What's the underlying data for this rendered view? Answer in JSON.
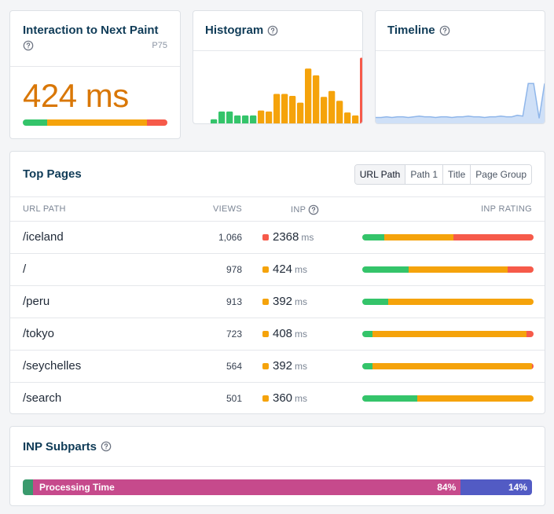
{
  "colors": {
    "good": "#34c46a",
    "needs_improvement": "#f5a30b",
    "poor": "#f65a4a",
    "accent_value": "#d97706"
  },
  "inp_card": {
    "title": "Interaction to Next Paint",
    "help_icon": "question-circle-icon",
    "percentile": "P75",
    "value": "424 ms",
    "rating_distribution": [
      0.14,
      0.58,
      0.12
    ]
  },
  "histogram": {
    "title": "Histogram",
    "help_icon": "question-circle-icon",
    "bars": [
      {
        "v": 0.05,
        "c": "good"
      },
      {
        "v": 0.13,
        "c": "good"
      },
      {
        "v": 0.13,
        "c": "good"
      },
      {
        "v": 0.09,
        "c": "good"
      },
      {
        "v": 0.09,
        "c": "good"
      },
      {
        "v": 0.09,
        "c": "good"
      },
      {
        "v": 0.14,
        "c": "needs_improvement"
      },
      {
        "v": 0.13,
        "c": "needs_improvement"
      },
      {
        "v": 0.31,
        "c": "needs_improvement"
      },
      {
        "v": 0.31,
        "c": "needs_improvement"
      },
      {
        "v": 0.29,
        "c": "needs_improvement"
      },
      {
        "v": 0.22,
        "c": "needs_improvement"
      },
      {
        "v": 0.57,
        "c": "needs_improvement"
      },
      {
        "v": 0.5,
        "c": "needs_improvement"
      },
      {
        "v": 0.28,
        "c": "needs_improvement"
      },
      {
        "v": 0.34,
        "c": "needs_improvement"
      },
      {
        "v": 0.24,
        "c": "needs_improvement"
      },
      {
        "v": 0.12,
        "c": "needs_improvement"
      },
      {
        "v": 0.09,
        "c": "needs_improvement"
      },
      {
        "v": 0.68,
        "c": "poor"
      }
    ]
  },
  "timeline": {
    "title": "Timeline",
    "help_icon": "question-circle-icon",
    "points": [
      0.09,
      0.09,
      0.1,
      0.09,
      0.1,
      0.1,
      0.09,
      0.1,
      0.11,
      0.1,
      0.1,
      0.09,
      0.1,
      0.1,
      0.09,
      0.1,
      0.1,
      0.11,
      0.1,
      0.1,
      0.09,
      0.1,
      0.1,
      0.11,
      0.1,
      0.1,
      0.12,
      0.11,
      0.55,
      0.55,
      0.08,
      0.55
    ]
  },
  "top_pages": {
    "title": "Top Pages",
    "tabs": [
      "URL Path",
      "Path 1",
      "Title",
      "Page Group"
    ],
    "columns": {
      "path": "URL PATH",
      "views": "VIEWS",
      "inp": "INP",
      "rating": "INP RATING"
    },
    "rows": [
      {
        "path": "/iceland",
        "views": "1,066",
        "inp": "2368",
        "unit": "ms",
        "status": "poor",
        "rating": [
          0.13,
          0.4,
          0.47
        ]
      },
      {
        "path": "/",
        "views": "978",
        "inp": "424",
        "unit": "ms",
        "status": "needs_improvement",
        "rating": [
          0.27,
          0.58,
          0.15
        ]
      },
      {
        "path": "/peru",
        "views": "913",
        "inp": "392",
        "unit": "ms",
        "status": "needs_improvement",
        "rating": [
          0.15,
          0.85,
          0.0
        ]
      },
      {
        "path": "/tokyo",
        "views": "723",
        "inp": "408",
        "unit": "ms",
        "status": "needs_improvement",
        "rating": [
          0.06,
          0.9,
          0.04
        ]
      },
      {
        "path": "/seychelles",
        "views": "564",
        "inp": "392",
        "unit": "ms",
        "status": "needs_improvement",
        "rating": [
          0.06,
          0.93,
          0.01
        ]
      },
      {
        "path": "/search",
        "views": "501",
        "inp": "360",
        "unit": "ms",
        "status": "needs_improvement",
        "rating": [
          0.32,
          0.68,
          0.0
        ]
      }
    ]
  },
  "subparts": {
    "title": "INP Subparts",
    "help_icon": "question-circle-icon",
    "segments": [
      {
        "label": "",
        "pct_label": "",
        "value": 0.02,
        "color": "#3a9a6d"
      },
      {
        "label": "Processing Time",
        "pct_label": "84%",
        "value": 0.84,
        "color": "#c64a8c"
      },
      {
        "label": "",
        "pct_label": "14%",
        "value": 0.14,
        "color": "#525bc4"
      }
    ]
  }
}
